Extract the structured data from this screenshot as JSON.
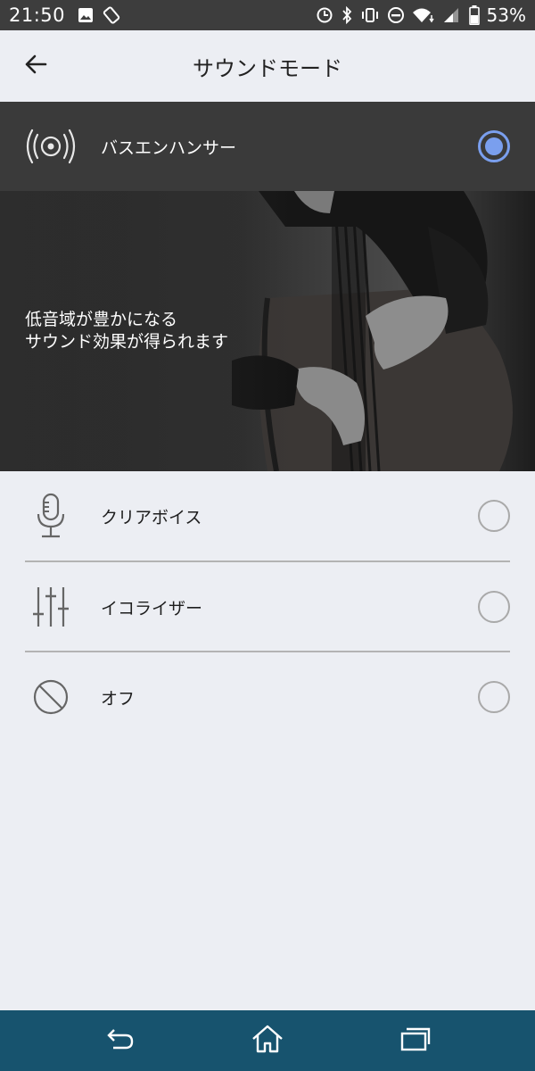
{
  "status_bar": {
    "time": "21:50",
    "battery_percent": "53%",
    "icons": [
      "image-icon",
      "screen-rotation-icon",
      "sync-icon",
      "bluetooth-icon",
      "vibrate-icon",
      "do-not-disturb-icon",
      "wifi-icon",
      "signal-icon",
      "battery-icon"
    ]
  },
  "header": {
    "title": "サウンドモード",
    "back_icon": "arrow-left-icon"
  },
  "selected_mode": {
    "label": "バスエンハンサー",
    "icon": "bass-speaker-icon",
    "selected": true,
    "description_line1": "低音域が豊かになる",
    "description_line2": "サウンド効果が得られます"
  },
  "options": [
    {
      "label": "クリアボイス",
      "icon": "microphone-icon",
      "selected": false
    },
    {
      "label": "イコライザー",
      "icon": "equalizer-icon",
      "selected": false
    },
    {
      "label": "オフ",
      "icon": "off-icon",
      "selected": false
    }
  ],
  "nav_bar": {
    "buttons": [
      "back-nav-icon",
      "home-icon",
      "recent-apps-icon"
    ]
  },
  "colors": {
    "accent": "#7a9fee",
    "nav_bar": "#17536e",
    "selected_row": "#3a3a3a",
    "background": "#eceef3"
  }
}
